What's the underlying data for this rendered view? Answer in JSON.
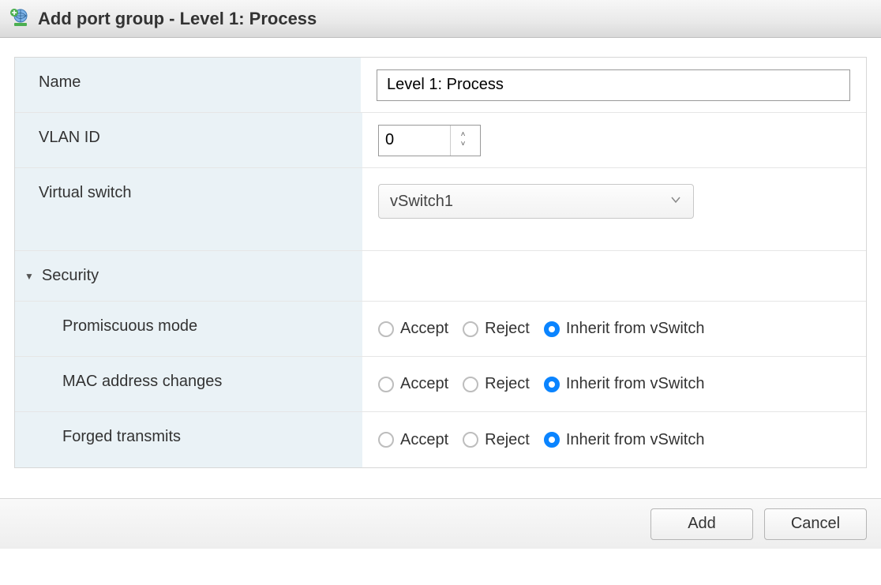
{
  "dialog": {
    "title": "Add port group - Level 1: Process"
  },
  "fields": {
    "name": {
      "label": "Name",
      "value": "Level 1: Process"
    },
    "vlan": {
      "label": "VLAN ID",
      "value": "0"
    },
    "vswitch": {
      "label": "Virtual switch",
      "selected": "vSwitch1"
    }
  },
  "security": {
    "section_label": "Security",
    "options": {
      "accept": "Accept",
      "reject": "Reject",
      "inherit": "Inherit from vSwitch"
    },
    "promiscuous": {
      "label": "Promiscuous mode",
      "value": "inherit"
    },
    "mac_changes": {
      "label": "MAC address changes",
      "value": "inherit"
    },
    "forged_transmits": {
      "label": "Forged transmits",
      "value": "inherit"
    }
  },
  "buttons": {
    "add": "Add",
    "cancel": "Cancel"
  }
}
